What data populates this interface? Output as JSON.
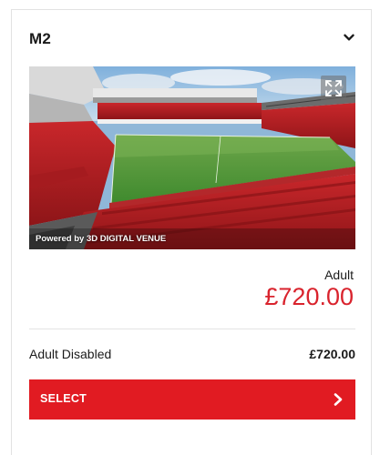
{
  "section": {
    "title": "M2",
    "toggle_icon": "chevron-down-icon"
  },
  "venue_view": {
    "powered_by": "Powered by 3D DIGITAL VENUE",
    "fullscreen_icon": "expand-icon"
  },
  "main_ticket": {
    "type": "Adult",
    "price": "£720.00"
  },
  "alt_ticket": {
    "type": "Adult Disabled",
    "price": "£720.00"
  },
  "select_button": {
    "label": "SELECT",
    "icon": "chevron-right-icon"
  },
  "colors": {
    "accent": "#e11b22",
    "price": "#d9232d"
  }
}
